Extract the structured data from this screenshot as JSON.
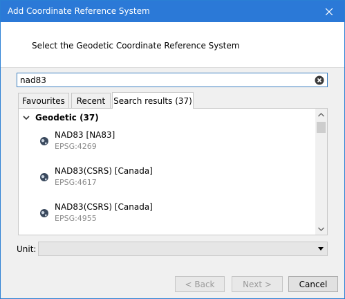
{
  "window": {
    "title": "Add Coordinate Reference System"
  },
  "header": {
    "instruction": "Select the Geodetic Coordinate Reference System"
  },
  "search": {
    "value": "nad83"
  },
  "tabs": [
    {
      "label": "Favourites",
      "active": false
    },
    {
      "label": "Recent",
      "active": false
    },
    {
      "label": "Search results (37)",
      "active": true
    }
  ],
  "results": {
    "group_label": "Geodetic (37)",
    "items": [
      {
        "name": "NAD83 [NA83]",
        "code": "EPSG:4269"
      },
      {
        "name": "NAD83(CSRS) [Canada]",
        "code": "EPSG:4617"
      },
      {
        "name": "NAD83(CSRS) [Canada]",
        "code": "EPSG:4955"
      }
    ]
  },
  "unit": {
    "label": "Unit:",
    "value": ""
  },
  "buttons": {
    "back": "< Back",
    "next": "Next >",
    "cancel": "Cancel"
  },
  "colors": {
    "titlebar": "#2b79d7",
    "search_border": "#3c7fc0"
  },
  "icons": {
    "clear": "clear-icon",
    "globe": "globe-icon",
    "close": "close-icon"
  }
}
